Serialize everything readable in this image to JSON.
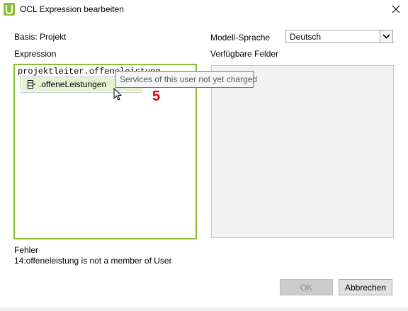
{
  "window": {
    "title": "OCL Expression bearbeiten"
  },
  "labels": {
    "basis": "Basis: Projekt",
    "expression": "Expression",
    "model_language": "Modell-Sprache",
    "available_fields": "Verfügbare Felder"
  },
  "language_select": {
    "value": "Deutsch"
  },
  "expression_editor": {
    "text": "projektleiter.offeneleistung"
  },
  "autocomplete": {
    "item_label": ".offeneLeistungen",
    "tooltip": "Services of this user not yet charged"
  },
  "annotation": {
    "marker": "5"
  },
  "error": {
    "title": "Fehler",
    "message": "14:offeneleistung is not a member of User"
  },
  "buttons": {
    "ok": "OK",
    "cancel": "Abbrechen"
  },
  "colors": {
    "accent_border": "#8cbb3c",
    "selected_item": "#e6f0d2",
    "marker": "#e00000"
  }
}
